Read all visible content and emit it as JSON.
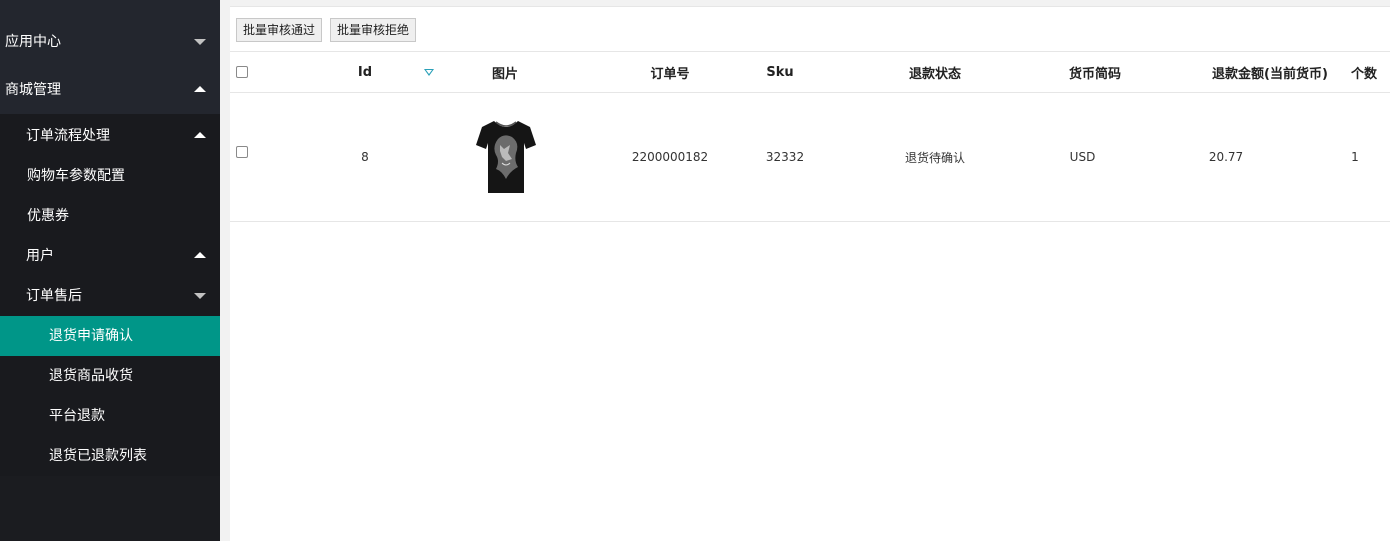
{
  "sidebar": {
    "app_center": "应用中心",
    "mall_management": "商城管理",
    "order_flow": "订单流程处理",
    "cart_config": "购物车参数配置",
    "coupons": "优惠券",
    "users": "用户",
    "after_sales": "订单售后",
    "return_confirm": "退货申请确认",
    "return_receive": "退货商品收货",
    "platform_refund": "平台退款",
    "refunded_list": "退货已退款列表"
  },
  "toolbar": {
    "batch_approve": "批量审核通过",
    "batch_reject": "批量审核拒绝"
  },
  "table": {
    "headers": {
      "id": "Id",
      "image": "图片",
      "order_no": "订单号",
      "sku": "Sku",
      "refund_status": "退款状态",
      "currency": "货币简码",
      "refund_amount": "退款金额(当前货币)",
      "quantity": "个数"
    },
    "rows": [
      {
        "id": "8",
        "image": "tshirt-image",
        "order_no": "2200000182",
        "sku": "32332",
        "refund_status": "退货待确认",
        "currency": "USD",
        "refund_amount": "20.77",
        "quantity": "1"
      }
    ]
  },
  "colors": {
    "sidebar_bg": "#1b1c20",
    "active_item": "#009688",
    "sort_icon": "#2aa0b8"
  }
}
